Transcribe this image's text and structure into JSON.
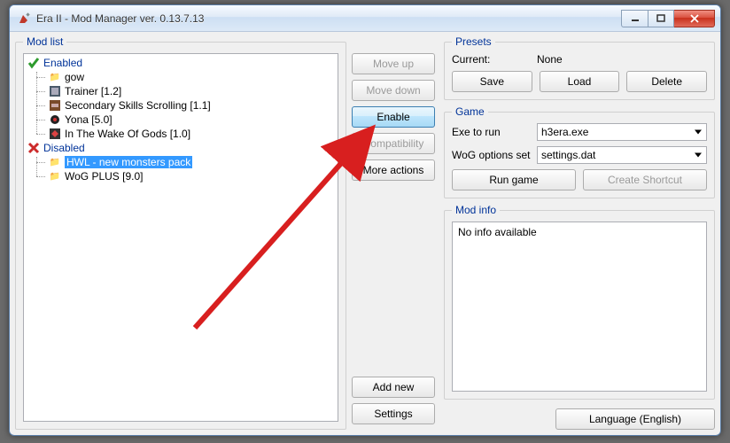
{
  "window": {
    "title": "Era II - Mod Manager ver. 0.13.7.13"
  },
  "modlist": {
    "legend": "Mod list",
    "enabled_label": "Enabled",
    "disabled_label": "Disabled",
    "enabled": [
      {
        "name": "gow"
      },
      {
        "name": "Trainer [1.2]"
      },
      {
        "name": "Secondary Skills Scrolling [1.1]"
      },
      {
        "name": "Yona [5.0]"
      },
      {
        "name": "In The Wake Of Gods [1.0]"
      }
    ],
    "disabled": [
      {
        "name": "HWL - new monsters pack",
        "selected": true
      },
      {
        "name": "WoG PLUS [9.0]"
      }
    ]
  },
  "mid_buttons": {
    "move_up": "Move up",
    "move_down": "Move down",
    "enable": "Enable",
    "compatibility": "Compatibility",
    "more_actions": "More actions",
    "add_new": "Add new",
    "settings": "Settings"
  },
  "presets": {
    "legend": "Presets",
    "current_label": "Current:",
    "current_value": "None",
    "save": "Save",
    "load": "Load",
    "delete": "Delete"
  },
  "game": {
    "legend": "Game",
    "exe_label": "Exe to run",
    "exe_value": "h3era.exe",
    "wog_label": "WoG options set",
    "wog_value": "settings.dat",
    "run": "Run game",
    "shortcut": "Create Shortcut"
  },
  "modinfo": {
    "legend": "Mod info",
    "text": "No info available"
  },
  "language_button": "Language (English)"
}
